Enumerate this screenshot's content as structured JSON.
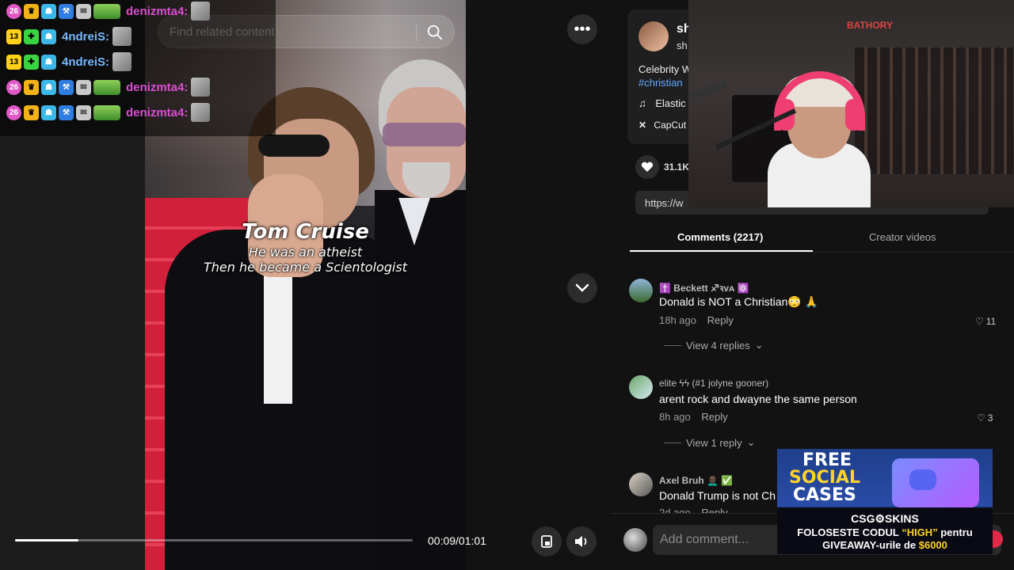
{
  "search": {
    "placeholder": "Find related content"
  },
  "video": {
    "caption_title": "Tom Cruise",
    "caption_line1": "He was an atheist",
    "caption_line2": "Then he became a Scientologist",
    "time": "00:09/01:01",
    "progress_fraction": 0.16
  },
  "chat": {
    "messages": [
      {
        "sub_months": "26",
        "user": "denizmta4:",
        "color": "#d94fd1"
      },
      {
        "sub_months": "13",
        "user": "4ndreiS:",
        "color": "#7ab7ff"
      },
      {
        "sub_months": "13",
        "user": "4ndreiS:",
        "color": "#7ab7ff"
      },
      {
        "sub_months": "26",
        "user": "denizmta4:",
        "color": "#d94fd1"
      },
      {
        "sub_months": "26",
        "user": "denizmta4:",
        "color": "#d94fd1"
      }
    ]
  },
  "creator": {
    "name": "sh",
    "handle": "sh",
    "description": "Celebrity W",
    "hashtag": "#christian",
    "music": "Elastic",
    "capcut": "CapCut"
  },
  "stats": {
    "likes": "31.1K"
  },
  "share": {
    "url": "https://w"
  },
  "tabs": {
    "comments": "Comments (2217)",
    "creator_videos": "Creator videos"
  },
  "comments": [
    {
      "user": "✝️ Beckett ♐︎ꝛᴠᴀ ⚛️",
      "text": "Donald is NOT a Christian😳 🙏",
      "time": "18h ago",
      "reply": "Reply",
      "likes": "11",
      "view_replies": "View 4 replies"
    },
    {
      "user": "elite ϟϟ (#1 jolyne gooner)",
      "text": "arent rock and dwayne the same person",
      "time": "8h ago",
      "reply": "Reply",
      "likes": "3",
      "view_replies": "View 1 reply"
    },
    {
      "user": "Axel Bruh 👨🏿‍🦲 ✅",
      "text": "Donald Trump is not Ch",
      "time": "2d ago",
      "reply": "Reply"
    }
  ],
  "comment_box": {
    "placeholder": "Add comment..."
  },
  "webcam": {
    "sign": "BATHORY"
  },
  "ad": {
    "line_free": "FREE",
    "line_social": "SOCIAL",
    "line_cases": "CASES",
    "brand": "CSG⚙SKINS",
    "promo_prefix": "FOLOSESTE CODUL ",
    "promo_code": "“HIGH”",
    "promo_suffix": " pentru",
    "giveaway_prefix": "GIVEAWAY-urile de ",
    "giveaway_amount": "$6000"
  },
  "colors": {
    "accent": "#e0284a",
    "link": "#60a8ff",
    "background": "#121212"
  }
}
